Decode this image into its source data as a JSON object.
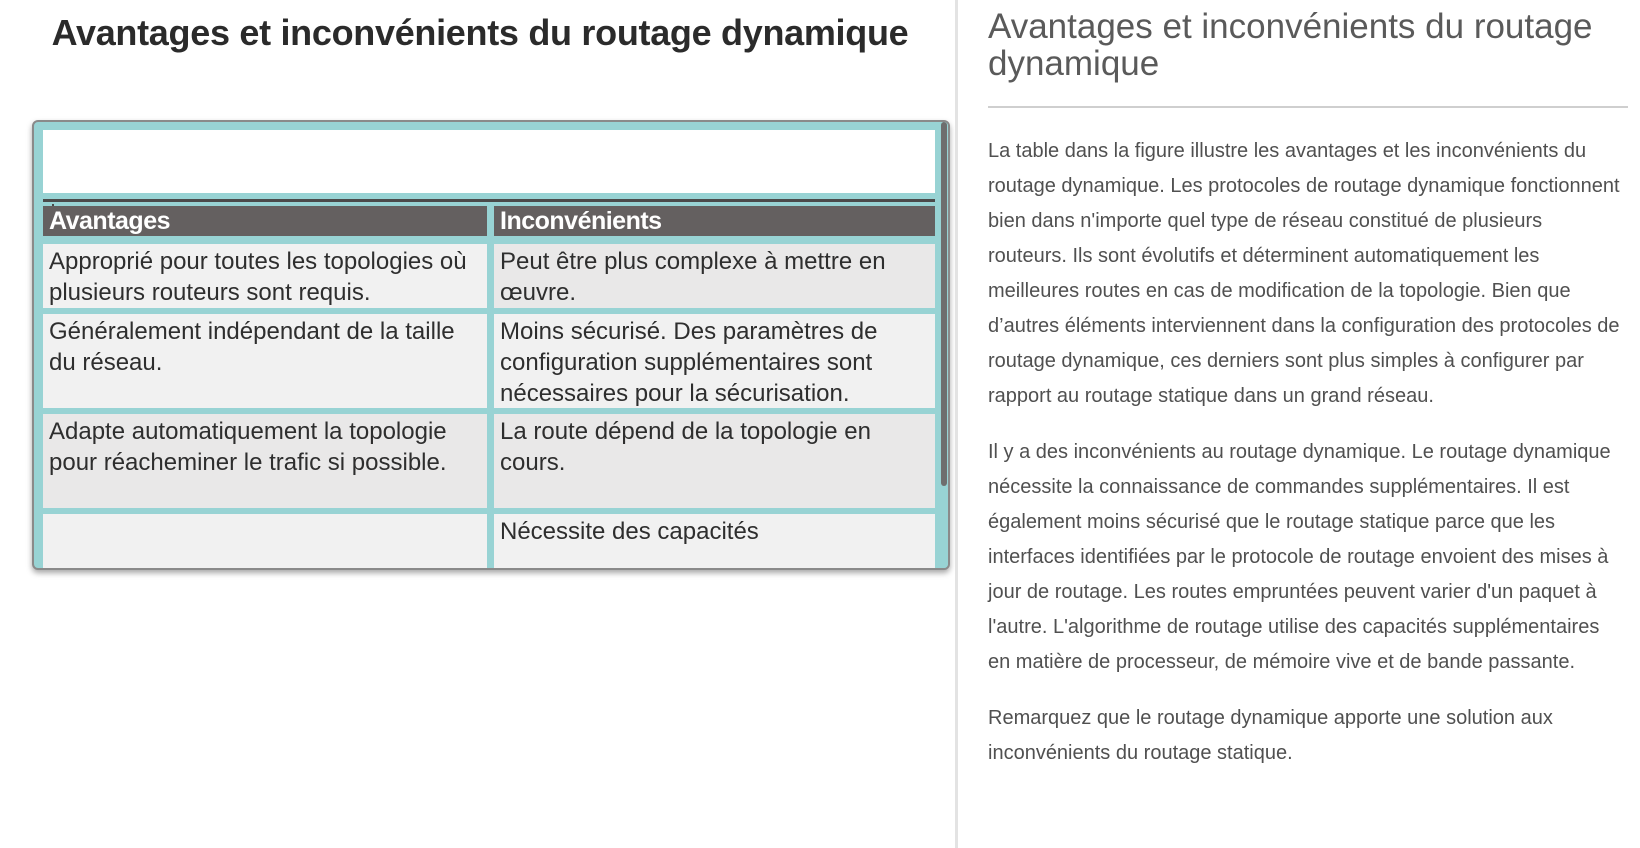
{
  "figure": {
    "title": "Avantages et inconvénients du routage dynamique",
    "table": {
      "headers": [
        "Avantages",
        "Inconvénients"
      ],
      "rows": [
        [
          "Approprié pour toutes les topologies où plusieurs routeurs sont requis.",
          "Peut être plus complexe à mettre en œuvre."
        ],
        [
          "Généralement indépendant de la taille du réseau.",
          "Moins sécurisé. Des paramètres de configuration supplémentaires sont nécessaires pour la sécurisation."
        ],
        [
          "Adapte automatiquement la topologie pour réacheminer le trafic si possible.",
          "La route dépend de la topologie en cours."
        ],
        [
          "",
          "Nécessite des capacités"
        ]
      ]
    }
  },
  "reader": {
    "title": "Avantages et inconvénients du routage dynamique",
    "paragraphs": [
      "La table dans la figure illustre les avantages et les inconvénients du routage dynamique. Les protocoles de routage dynamique fonctionnent bien dans n'importe quel type de réseau constitué de plusieurs routeurs. Ils sont évolutifs et déterminent automatiquement les meilleures routes en cas de modification de la topologie. Bien que d’autres éléments interviennent dans la configuration des protocoles de routage dynamique, ces derniers sont plus simples à configurer par rapport au routage statique dans un grand réseau.",
      "Il y a des inconvénients au routage dynamique. Le routage dynamique nécessite la connaissance de commandes supplémentaires. Il est également moins sécurisé que le routage statique parce que les interfaces identifiées par le protocole de routage envoient des mises à jour de routage. Les routes empruntées peuvent varier d'un paquet à l'autre. L'algorithme de routage utilise des capacités supplémentaires en matière de processeur, de mémoire vive et de bande passante.",
      "Remarquez que le routage dynamique apporte une solution aux inconvénients du routage statique."
    ]
  },
  "colors": {
    "table_frame": "#98d3d4",
    "table_header": "#646060",
    "handle_accent": "#2a9fd6"
  },
  "icons": {
    "resize_handle": "vertical-dots-icon"
  }
}
